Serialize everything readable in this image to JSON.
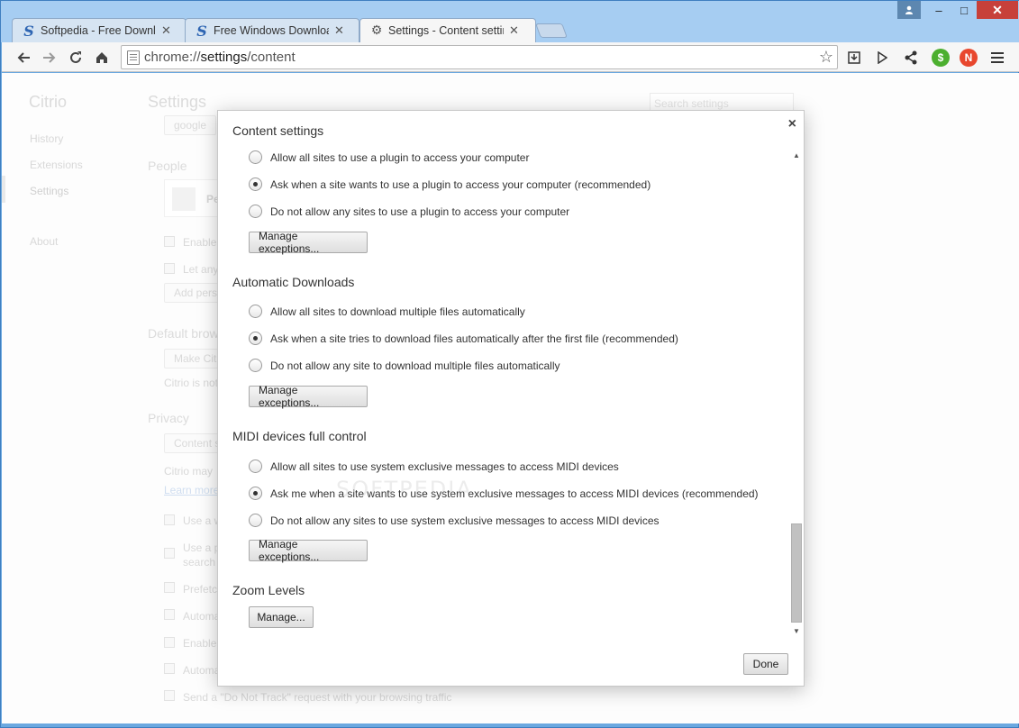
{
  "window": {
    "user_icon": "user-icon",
    "minimize": "–",
    "maximize": "□",
    "close": "✕"
  },
  "tabs": [
    {
      "favicon": "S",
      "label": "Softpedia - Free Downloa"
    },
    {
      "favicon": "S",
      "label": "Free Windows Downloads"
    },
    {
      "favicon": "⚙",
      "label": "Settings - Content setting"
    }
  ],
  "toolbar": {
    "url_scheme": "chrome://",
    "url_host": "settings",
    "url_path": "/content",
    "ext_green_label": "$",
    "ext_red_label": "N"
  },
  "background": {
    "brand": "Citrio",
    "nav": [
      "History",
      "Extensions",
      "Settings",
      "About"
    ],
    "heading": "Settings",
    "search_placeholder": "Search settings",
    "google_btn": "google",
    "people_heading": "People",
    "person_label": "Pe",
    "enable_label": "Enable",
    "let_any_label": "Let any",
    "add_person_btn": "Add pers",
    "default_browser_heading": "Default brow",
    "make_citrio_btn": "Make Citr",
    "citrio_is_not": "Citrio is not",
    "privacy_heading": "Privacy",
    "content_settings_btn": "Content se",
    "citrio_may": "Citrio may",
    "learn_more": "Learn more",
    "use_a_w": "Use a w",
    "use_a_p": "Use a p",
    "search_word": "search",
    "prefetch": "Prefetc",
    "automa1": "Automa",
    "enable2": "Enable",
    "automa2": "Automa",
    "do_not_track": "Send a \"Do Not Track\" request with your browsing traffic"
  },
  "dialog": {
    "title": "Content settings",
    "close": "×",
    "plugins": {
      "options": [
        "Allow all sites to use a plugin to access your computer",
        "Ask when a site wants to use a plugin to access your computer (recommended)",
        "Do not allow any sites to use a plugin to access your computer"
      ],
      "selected": 1,
      "button": "Manage exceptions..."
    },
    "auto_downloads": {
      "title": "Automatic Downloads",
      "options": [
        "Allow all sites to download multiple files automatically",
        "Ask when a site tries to download files automatically after the first file (recommended)",
        "Do not allow any site to download multiple files automatically"
      ],
      "selected": 1,
      "button": "Manage exceptions..."
    },
    "midi": {
      "title": "MIDI devices full control",
      "options": [
        "Allow all sites to use system exclusive messages to access MIDI devices",
        "Ask me when a site wants to use system exclusive messages to access MIDI devices (recommended)",
        "Do not allow any sites to use system exclusive messages to access MIDI devices"
      ],
      "selected": 1,
      "button": "Manage exceptions..."
    },
    "zoom": {
      "title": "Zoom Levels",
      "button": "Manage..."
    },
    "done": "Done",
    "watermark": "SOFTPEDIA"
  }
}
